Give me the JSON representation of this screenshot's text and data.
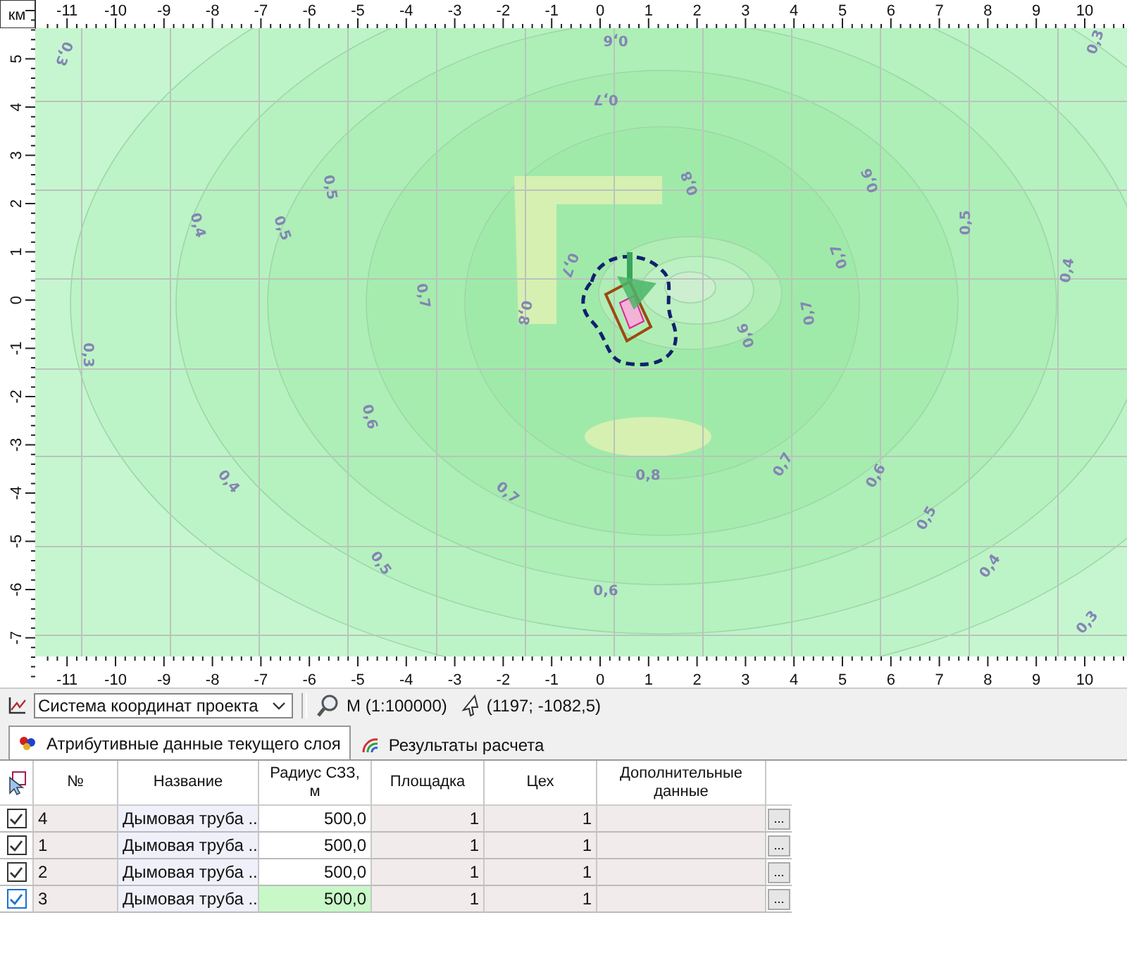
{
  "map": {
    "unit": "км",
    "top_ticks": [
      "-11",
      "-10",
      "-9",
      "-8",
      "-7",
      "-6",
      "-5",
      "-4",
      "-3",
      "-2",
      "-1",
      "0",
      "1",
      "2",
      "3",
      "4",
      "5",
      "6",
      "7",
      "8",
      "9",
      "10"
    ],
    "left_ticks": [
      "5",
      "4",
      "3",
      "2",
      "1",
      "0",
      "-1",
      "-2",
      "-3",
      "-4",
      "-5",
      "-6",
      "-7"
    ],
    "bottom_ticks": [
      "-11",
      "-10",
      "-9",
      "-8",
      "-7",
      "-6",
      "-5",
      "-4",
      "-3",
      "-2",
      "-1",
      "0",
      "1",
      "2",
      "3",
      "4",
      "5",
      "6",
      "7",
      "8",
      "9",
      "10"
    ],
    "contour_labels": [
      "0,3",
      "0,3",
      "0,3",
      "0,3",
      "0,4",
      "0,4",
      "0,4",
      "0,4",
      "0,5",
      "0,5",
      "0,5",
      "0,5",
      "0,5",
      "0,6",
      "0,6",
      "0,6",
      "0,6",
      "0,6",
      "0,7",
      "0,7",
      "0,7",
      "0,7",
      "0,7",
      "0,7",
      "0,7",
      "0,8",
      "0,8",
      "0,8",
      "0,6"
    ]
  },
  "toolbar": {
    "coordinate_system": "Система координат проекта",
    "scale": "М (1:100000)",
    "cursor": "(1197; -1082,5)"
  },
  "tabs": [
    {
      "label": "Атрибутивные данные текущего слоя",
      "selected": true
    },
    {
      "label": "Результаты расчета",
      "selected": false
    }
  ],
  "table": {
    "columns": [
      "№",
      "Название",
      "Радиус СЗЗ, м",
      "Площадка",
      "Цех",
      "Дополнительные данные"
    ],
    "rows": [
      {
        "checked": true,
        "selected": false,
        "number": "4",
        "name": "Дымовая труба ...",
        "radius": "500,0",
        "site": "1",
        "shop": "1",
        "more": "..."
      },
      {
        "checked": true,
        "selected": false,
        "number": "1",
        "name": "Дымовая труба ...",
        "radius": "500,0",
        "site": "1",
        "shop": "1",
        "more": "..."
      },
      {
        "checked": true,
        "selected": false,
        "number": "2",
        "name": "Дымовая труба ...",
        "radius": "500,0",
        "site": "1",
        "shop": "1",
        "more": "..."
      },
      {
        "checked": true,
        "selected": true,
        "number": "3",
        "name": "Дымовая труба ...",
        "radius": "500,0",
        "site": "1",
        "shop": "1",
        "more": "..."
      }
    ]
  }
}
